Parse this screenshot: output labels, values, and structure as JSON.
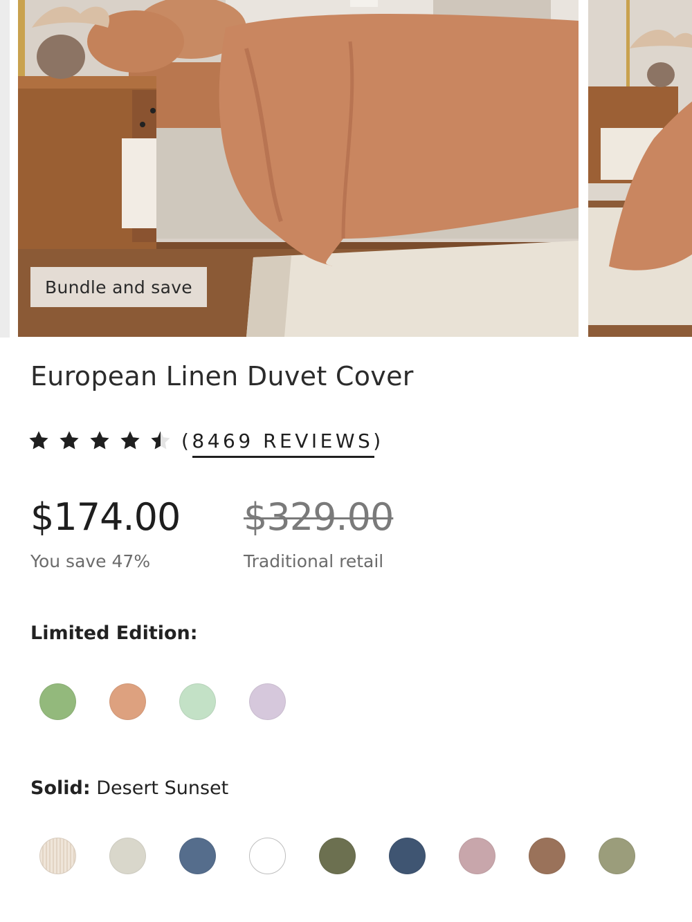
{
  "gallery": {
    "badge_label": "Bundle and save"
  },
  "product": {
    "title": "European Linen Duvet Cover",
    "rating": 4.5,
    "reviews_label": "(8469 REVIEWS)"
  },
  "pricing": {
    "price": "$174.00",
    "savings": "You save 47%",
    "retail_price": "$329.00",
    "retail_label": "Traditional retail"
  },
  "limited_edition": {
    "label": "Limited Edition:",
    "swatches": [
      {
        "color": "#93b97c"
      },
      {
        "color": "#dda17f"
      },
      {
        "color": "#c3e1c6"
      },
      {
        "color": "#d6c8dc"
      }
    ]
  },
  "solid": {
    "label": "Solid:",
    "selected": "Desert Sunset",
    "swatches": [
      {
        "color": "#ece2d4",
        "pattern": "stripe"
      },
      {
        "color": "#d9d7cb"
      },
      {
        "color": "#556d8c"
      },
      {
        "color": "#ffffff"
      },
      {
        "color": "#6c7050"
      },
      {
        "color": "#3f5572"
      },
      {
        "color": "#c8a6ab"
      },
      {
        "color": "#9a725a"
      },
      {
        "color": "#9b9d7b"
      }
    ]
  }
}
